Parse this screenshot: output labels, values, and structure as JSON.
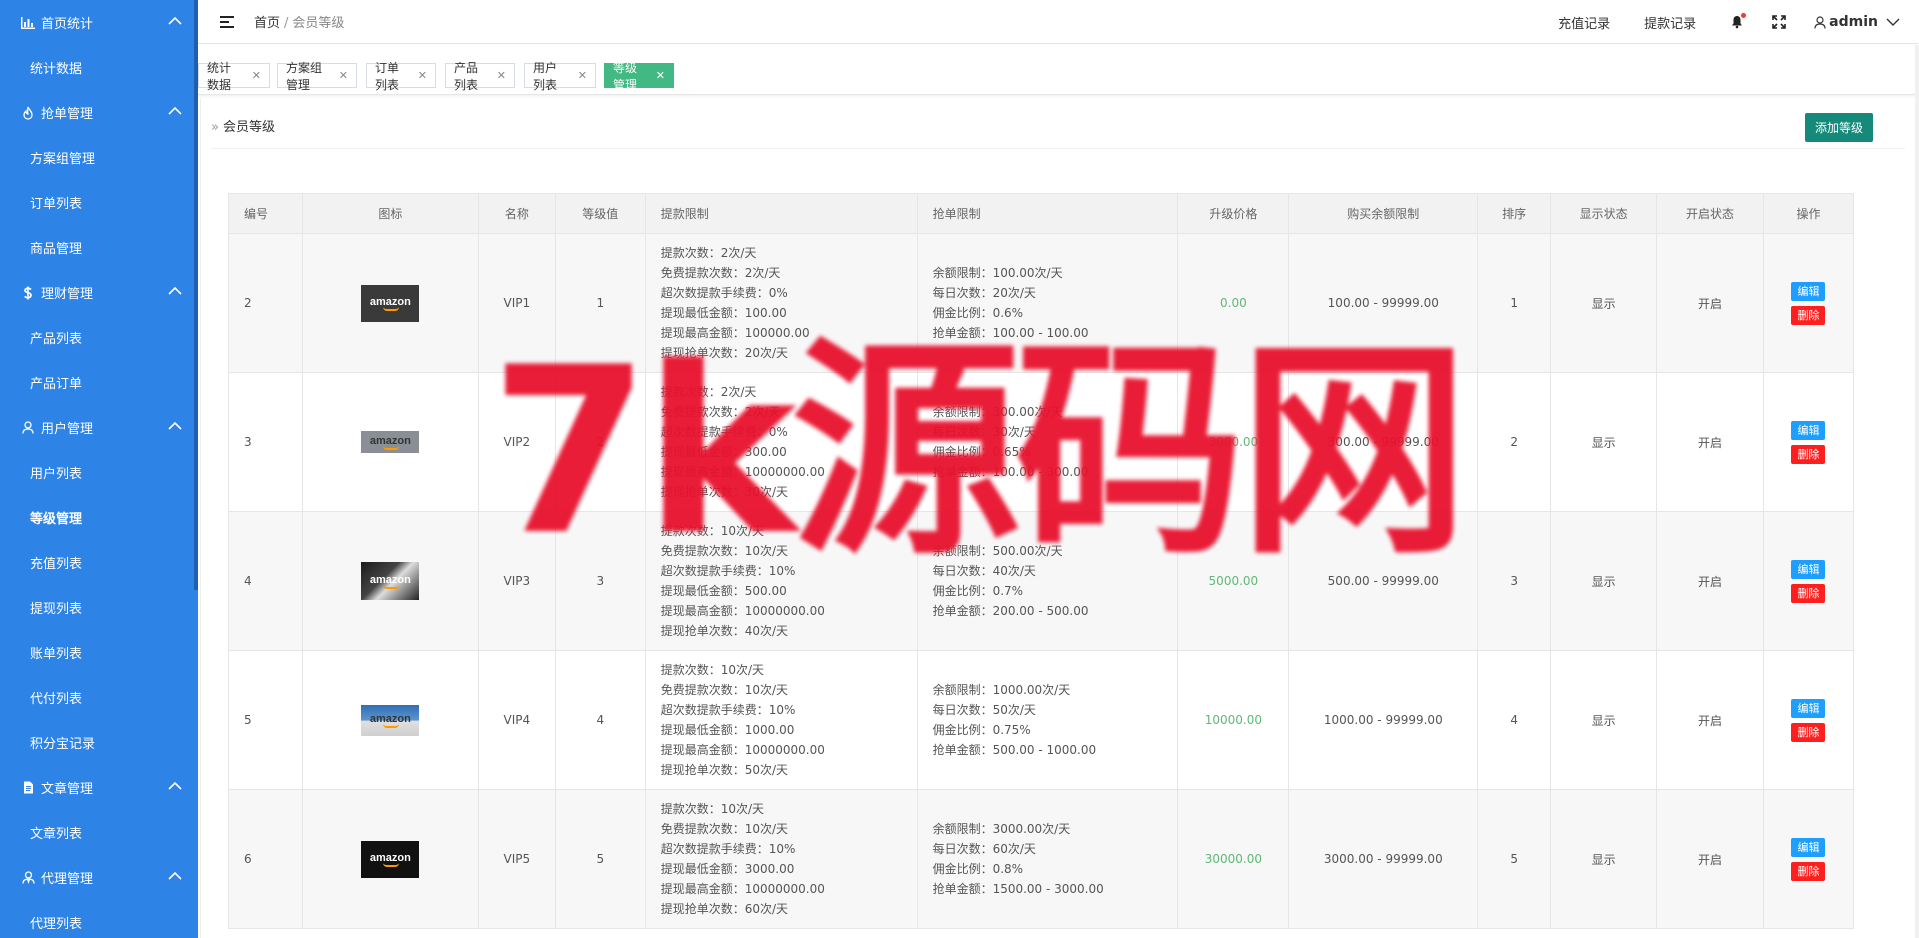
{
  "sidebar": {
    "groups": [
      {
        "label": "首页统计",
        "icon": "bar-chart-icon",
        "items": [
          "统计数据"
        ]
      },
      {
        "label": "抢单管理",
        "icon": "fire-icon",
        "items": [
          "方案组管理",
          "订单列表",
          "商品管理"
        ]
      },
      {
        "label": "理财管理",
        "icon": "dollar-icon",
        "items": [
          "产品列表",
          "产品订单"
        ]
      },
      {
        "label": "用户管理",
        "icon": "user-icon",
        "items": [
          "用户列表",
          "等级管理",
          "充值列表",
          "提现列表",
          "账单列表",
          "代付列表",
          "积分宝记录"
        ]
      },
      {
        "label": "文章管理",
        "icon": "document-icon",
        "items": [
          "文章列表"
        ]
      },
      {
        "label": "代理管理",
        "icon": "agent-icon",
        "items": [
          "代理列表"
        ]
      }
    ],
    "active_item": "等级管理"
  },
  "header": {
    "breadcrumb_home": "首页",
    "breadcrumb_sep": "/",
    "breadcrumb_current": "会员等级",
    "recharge_link": "充值记录",
    "withdraw_link": "提款记录",
    "username": "admin"
  },
  "tabs": [
    {
      "label": "统计数据",
      "active": false
    },
    {
      "label": "方案组管理",
      "active": false
    },
    {
      "label": "订单列表",
      "active": false
    },
    {
      "label": "产品列表",
      "active": false
    },
    {
      "label": "用户列表",
      "active": false
    },
    {
      "label": "等级管理",
      "active": true
    }
  ],
  "page": {
    "title_arrows": "»",
    "title": "会员等级",
    "add_button": "添加等级"
  },
  "table": {
    "columns": [
      "编号",
      "图标",
      "名称",
      "等级值",
      "提款限制",
      "抢单限制",
      "升级价格",
      "购买余额限制",
      "排序",
      "显示状态",
      "开启状态",
      "操作"
    ],
    "rows": [
      {
        "id": "2",
        "name": "VIP1",
        "level": "1",
        "withdraw": [
          "提款次数：2次/天",
          "免费提款次数：2次/天",
          "超次数提款手续费：0%",
          "提现最低金额：100.00",
          "提现最高金额：100000.00",
          "提现抢单次数：20次/天"
        ],
        "grab": [
          "余额限制：100.00次/天",
          "每日次数：20次/天",
          "佣金比例：0.6%",
          "抢单金额：100.00 - 100.00"
        ],
        "price": "0.00",
        "balance": "100.00 - 99999.00",
        "sort": "1",
        "display": "显示",
        "status": "开启",
        "logo": "amazon-dark"
      },
      {
        "id": "3",
        "name": "VIP2",
        "level": "2",
        "withdraw": [
          "提款次数：2次/天",
          "免费提款次数：2次/天",
          "超次数提款手续费：0%",
          "提现最低金额：300.00",
          "提现最高金额：10000000.00",
          "提现抢单次数：30次/天"
        ],
        "grab": [
          "余额限制：300.00次/天",
          "每日次数：30次/天",
          "佣金比例：0.65%",
          "抢单金额：100.00 - 300.00"
        ],
        "price": "3000.00",
        "balance": "300.00 - 99999.00",
        "sort": "2",
        "display": "显示",
        "status": "开启",
        "logo": "amazon-grey"
      },
      {
        "id": "4",
        "name": "VIP3",
        "level": "3",
        "withdraw": [
          "提款次数：10次/天",
          "免费提款次数：10次/天",
          "超次数提款手续费：10%",
          "提现最低金额：500.00",
          "提现最高金额：10000000.00",
          "提现抢单次数：40次/天"
        ],
        "grab": [
          "余额限制：500.00次/天",
          "每日次数：40次/天",
          "佣金比例：0.7%",
          "抢单金额：200.00 - 500.00"
        ],
        "price": "5000.00",
        "balance": "500.00 - 99999.00",
        "sort": "3",
        "display": "显示",
        "status": "开启",
        "logo": "amazon-boxes"
      },
      {
        "id": "5",
        "name": "VIP4",
        "level": "4",
        "withdraw": [
          "提款次数：10次/天",
          "免费提款次数：10次/天",
          "超次数提款手续费：10%",
          "提现最低金额：1000.00",
          "提现最高金额：10000000.00",
          "提现抢单次数：50次/天"
        ],
        "grab": [
          "余额限制：1000.00次/天",
          "每日次数：50次/天",
          "佣金比例：0.75%",
          "抢单金额：500.00 - 1000.00"
        ],
        "price": "10000.00",
        "balance": "1000.00 - 99999.00",
        "sort": "4",
        "display": "显示",
        "status": "开启",
        "logo": "amazon-sky"
      },
      {
        "id": "6",
        "name": "VIP5",
        "level": "5",
        "withdraw": [
          "提款次数：10次/天",
          "免费提款次数：10次/天",
          "超次数提款手续费：10%",
          "提现最低金额：3000.00",
          "提现最高金额：10000000.00",
          "提现抢单次数：60次/天"
        ],
        "grab": [
          "余额限制：3000.00次/天",
          "每日次数：60次/天",
          "佣金比例：0.8%",
          "抢单金额：1500.00 - 3000.00"
        ],
        "price": "30000.00",
        "balance": "3000.00 - 99999.00",
        "sort": "5",
        "display": "显示",
        "status": "开启",
        "logo": "amazon-black"
      }
    ],
    "edit_label": "编辑",
    "delete_label": "删除"
  },
  "watermark": "7k源码网",
  "colors": {
    "sidebar_bg": "#2e83e6",
    "tab_active": "#42b983",
    "add_button": "#168a7a",
    "edit_button": "#1e9fff",
    "delete_button": "#ff1f1f",
    "price_green": "#5fb878",
    "watermark_red": "#e8112d"
  }
}
